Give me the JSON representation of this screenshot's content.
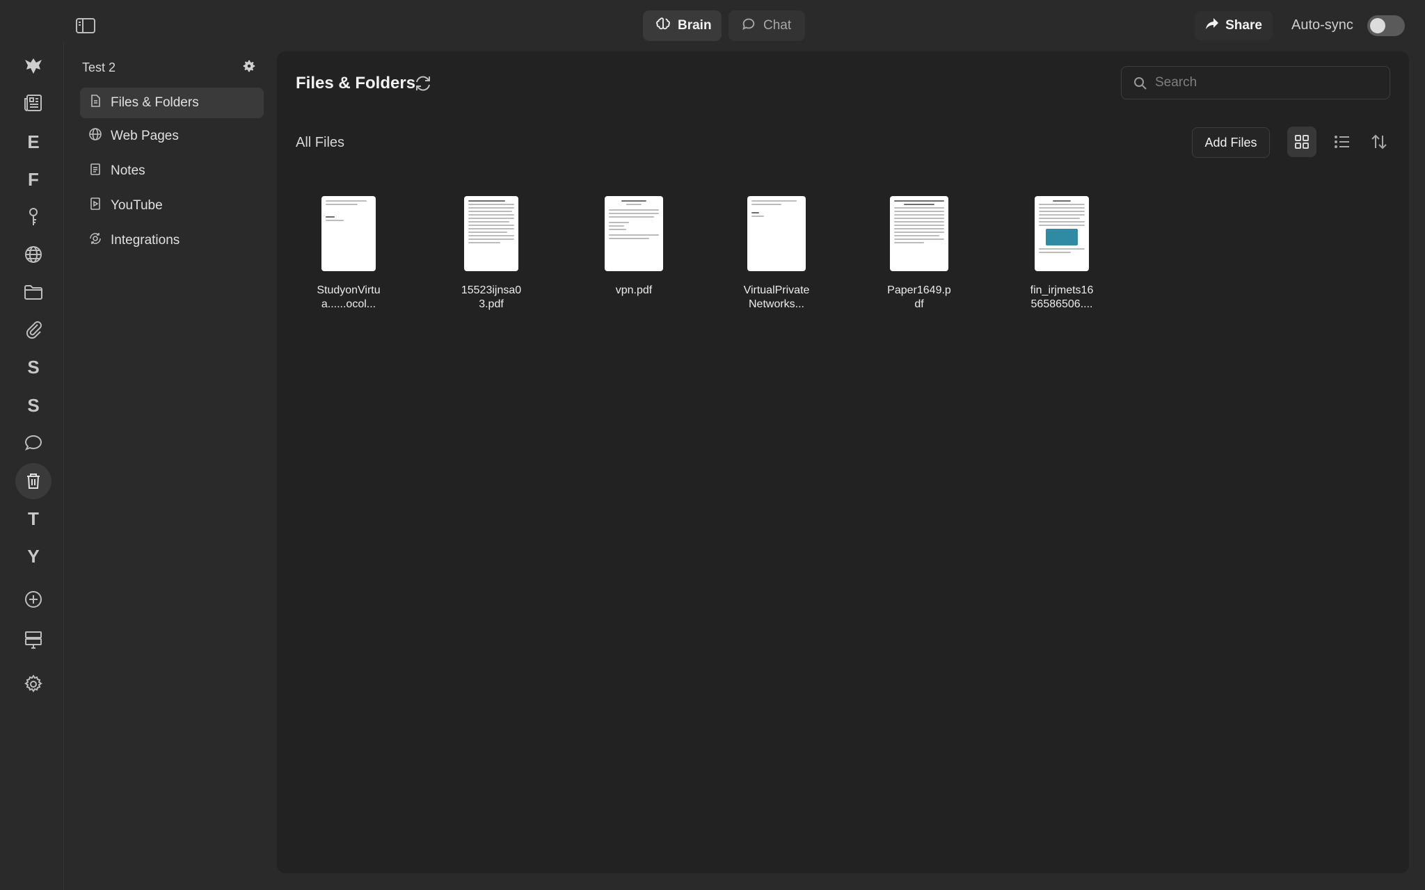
{
  "topbar": {
    "brain_label": "Brain",
    "chat_label": "Chat",
    "share_label": "Share",
    "autosync_label": "Auto-sync",
    "autosync_on": false
  },
  "rail": {
    "letters": [
      "E",
      "F",
      "S",
      "S",
      "T",
      "Y"
    ]
  },
  "nav": {
    "workspace_name": "Test 2",
    "items": [
      {
        "label": "Files & Folders",
        "icon": "file-icon"
      },
      {
        "label": "Web Pages",
        "icon": "globe-icon"
      },
      {
        "label": "Notes",
        "icon": "note-icon"
      },
      {
        "label": "YouTube",
        "icon": "video-icon"
      },
      {
        "label": "Integrations",
        "icon": "integrations-icon"
      }
    ]
  },
  "main": {
    "title": "Files & Folders",
    "search_placeholder": "Search",
    "section_label": "All Files",
    "add_files_label": "Add Files",
    "files": [
      {
        "name": "StudyonVirtua......ocol..."
      },
      {
        "name": "15523ijnsa03.pdf"
      },
      {
        "name": "vpn.pdf"
      },
      {
        "name": "VirtualPrivateNetworks..."
      },
      {
        "name": "Paper1649.pdf"
      },
      {
        "name": "fin_irjmets1656586506...."
      }
    ]
  },
  "colors": {
    "background": "#2a2a2a",
    "panel": "#222222",
    "active": "#3a3a3a"
  }
}
